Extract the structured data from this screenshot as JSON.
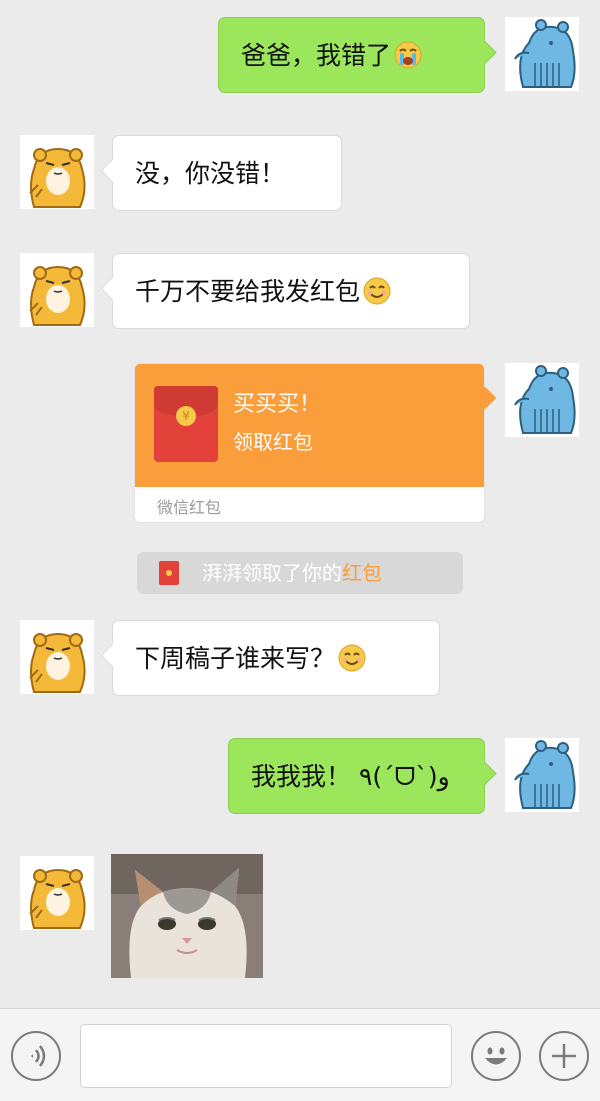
{
  "messages": [
    {
      "side": "right",
      "text": "爸爸，我错了",
      "emoji": "crying-face"
    },
    {
      "side": "left",
      "text": "没，你没错！"
    },
    {
      "side": "left",
      "text": "千万不要给我发红包",
      "emoji": "smiling-face"
    },
    {
      "side": "right",
      "type": "red_packet",
      "title": "买买买！",
      "subtitle": "领取红包",
      "footer": "微信红包"
    },
    {
      "side": "system",
      "text_prefix": "湃湃领取了你的",
      "text_highlight": "红包"
    },
    {
      "side": "left",
      "text": "下周稿子谁来写？",
      "emoji": "smiling-face"
    },
    {
      "side": "right",
      "text": "我我我！ ٩(ˊᗜˋ)و"
    },
    {
      "side": "left",
      "type": "image",
      "image": "cat-photo"
    }
  ],
  "avatars": {
    "self": "blue-bear-avatar",
    "friend": "orange-hamster-avatar"
  },
  "colors": {
    "background": "#ebebeb",
    "self_bubble": "#9be65b",
    "friend_bubble": "#ffffff",
    "red_packet": "#fa9d3b",
    "highlight": "#fa9d3b"
  },
  "input_bar": {
    "voice_icon": "voice-icon",
    "emoji_icon": "emoji-icon",
    "plus_icon": "plus-icon"
  }
}
